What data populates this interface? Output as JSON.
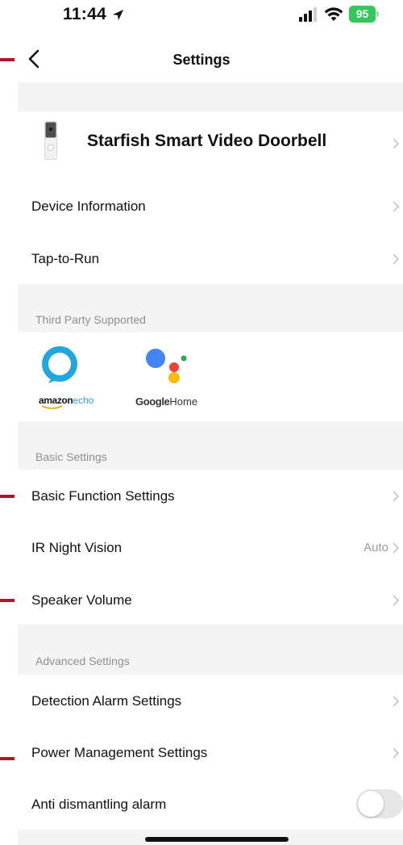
{
  "status_bar": {
    "time": "11:44",
    "battery": "95",
    "battery_color": "#34c759"
  },
  "nav": {
    "title": "Settings",
    "back_icon": "chevron-left-icon"
  },
  "device": {
    "name": "Starfish Smart Video Doorbell"
  },
  "general_items": [
    {
      "label": "Device Information"
    },
    {
      "label": "Tap-to-Run"
    }
  ],
  "third_party": {
    "header": "Third Party Supported",
    "alexa": {
      "brand": "amazon",
      "product": "echo"
    },
    "google": {
      "brand": "Google",
      "product": "Home"
    }
  },
  "basic_settings": {
    "header": "Basic Settings",
    "items": [
      {
        "label": "Basic Function Settings"
      },
      {
        "label": "IR Night Vision",
        "value": "Auto"
      },
      {
        "label": "Speaker Volume"
      }
    ]
  },
  "advanced_settings": {
    "header": "Advanced Settings",
    "items": [
      {
        "label": "Detection Alarm Settings"
      },
      {
        "label": "Power Management Settings"
      },
      {
        "label": "Anti dismantling alarm",
        "toggle_on": false
      }
    ]
  },
  "colors": {
    "annotation_mark": "#b0162a",
    "section_gap": "#f4f4f4",
    "alexa_blue": "#1fa8e0"
  }
}
